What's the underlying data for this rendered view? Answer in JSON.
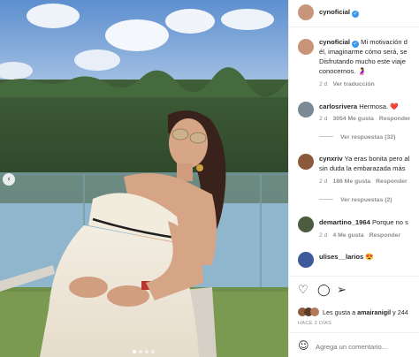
{
  "post": {
    "author": "cynoficial",
    "caption_lines": [
      "Mi motivación d",
      "él, imaginarme cómo será, se",
      "Disfrutando mucho este viaje",
      "conocernos. 🤰"
    ],
    "caption_age": "2 d",
    "see_translation": "Ver traducción"
  },
  "comments": [
    {
      "user": "carlosrivera",
      "text": "Hermosa. ❤️",
      "age": "2 d",
      "likes": "3054 Me gusta",
      "reply": "Responder",
      "view_replies": "Ver respuestas (32)"
    },
    {
      "user": "cynxriv",
      "text_lines": [
        "Ya eras bonita pero al",
        "sin duda la embarazada más"
      ],
      "age": "2 d",
      "likes": "186 Me gusta",
      "reply": "Responder",
      "view_replies": "Ver respuestas (2)"
    },
    {
      "user": "demartino_1964",
      "text": "Porque no s",
      "age": "2 d",
      "likes": "4 Me gusta",
      "reply": "Responder",
      "view_replies": ""
    },
    {
      "user": "ulises__larios",
      "text": "😍",
      "age": "",
      "likes": "",
      "reply": "",
      "view_replies": ""
    }
  ],
  "likes_line": {
    "prefix": "Les gusta a",
    "user": "amairanigil",
    "suffix": "y 244"
  },
  "timestamp": "HACE 2 DÍAS",
  "comment_box": {
    "placeholder": "Agrega un comentario..."
  },
  "carousel": {
    "slide_count": 4,
    "active": 0
  },
  "colors": {
    "verified": "#3897f0",
    "heart": "#ed4956",
    "muted": "#8e8e8e"
  }
}
